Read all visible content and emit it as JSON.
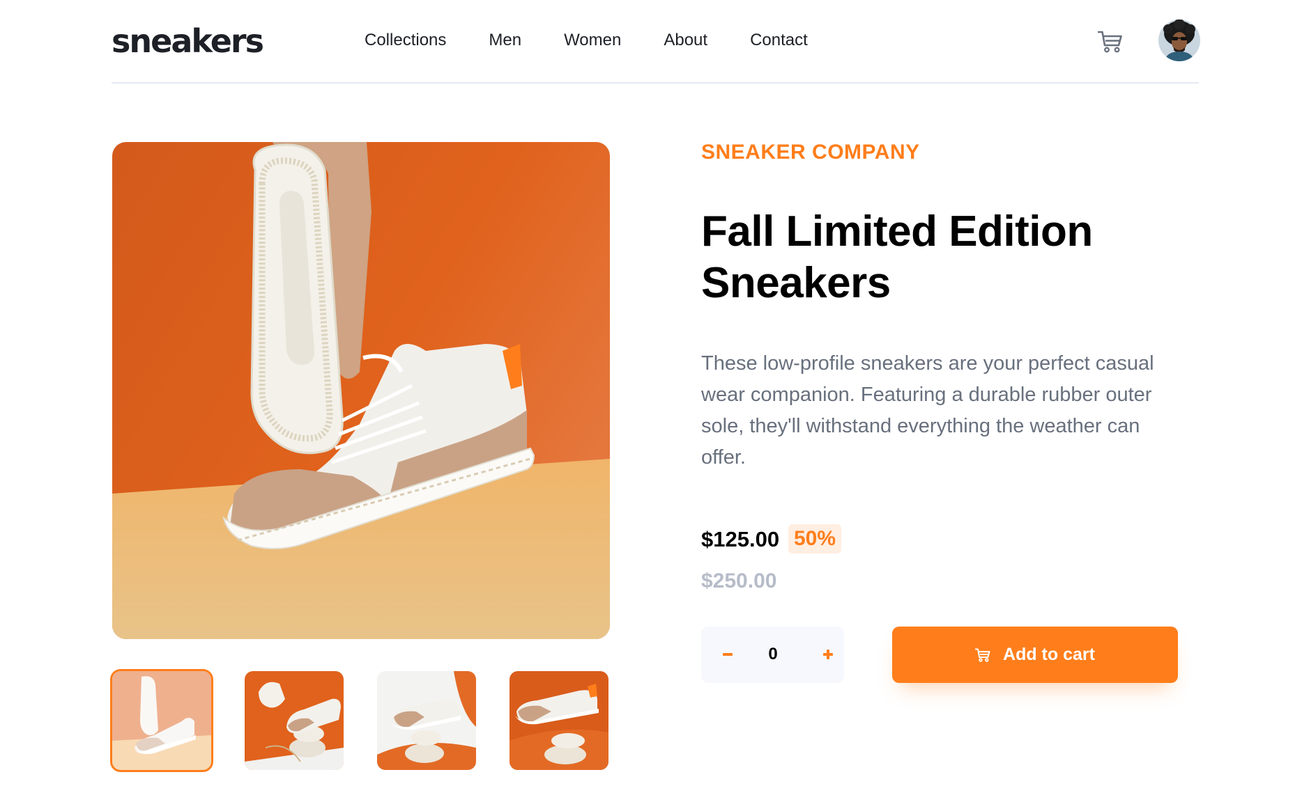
{
  "header": {
    "logo": "sneakers",
    "nav": [
      "Collections",
      "Men",
      "Women",
      "About",
      "Contact"
    ]
  },
  "product": {
    "brand": "SNEAKER COMPANY",
    "title_line1": "Fall Limited Edition",
    "title_line2": "Sneakers",
    "description": "These low-profile sneakers are your perfect casual wear companion. Featuring a durable rubber outer sole, they'll withstand everything the weather can offer.",
    "price": "$125.00",
    "discount": "50%",
    "original_price": "$250.00",
    "quantity": "0",
    "add_to_cart": "Add to cart"
  },
  "colors": {
    "accent": "#ff7e1b",
    "accent_pale": "#ffeee2",
    "text_dark": "#1d2026",
    "text_grey": "#68707d",
    "text_light": "#b6bcc8",
    "qty_bg": "#f6f8fd"
  },
  "icons": {
    "cart": "cart-icon",
    "avatar": "user-avatar",
    "minus": "minus-icon",
    "plus": "plus-icon"
  },
  "gallery": {
    "selected_thumbnail": 1,
    "thumbnail_count": 4
  }
}
